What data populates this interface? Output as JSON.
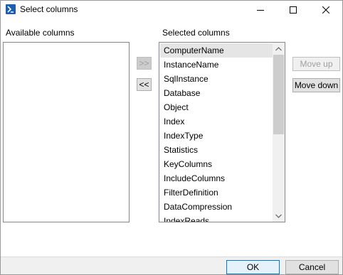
{
  "window": {
    "title": "Select columns",
    "icon": "powershell-icon",
    "controls": [
      "minimize-icon",
      "maximize-icon",
      "close-icon"
    ]
  },
  "available": {
    "label": "Available columns",
    "items": []
  },
  "selected": {
    "label": "Selected columns",
    "items": [
      "ComputerName",
      "InstanceName",
      "SqlInstance",
      "Database",
      "Object",
      "Index",
      "IndexType",
      "Statistics",
      "KeyColumns",
      "IncludeColumns",
      "FilterDefinition",
      "DataCompression",
      "IndexReads"
    ],
    "selected_index": 0
  },
  "transfer": {
    "add_label": ">>",
    "remove_label": "<<"
  },
  "ordering": {
    "move_up_label": "Move up",
    "move_down_label": "Move down"
  },
  "footer": {
    "ok_label": "OK",
    "cancel_label": "Cancel"
  },
  "colors": {
    "accent": "#0078d7",
    "selection": "#e5e5e5"
  }
}
